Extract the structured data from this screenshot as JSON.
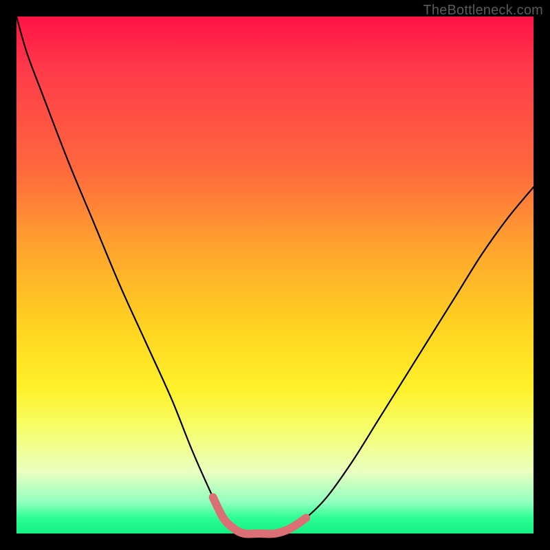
{
  "watermark": "TheBottleneck.com",
  "colors": {
    "background_outer": "#000000",
    "gradient_top": "#ff1245",
    "gradient_mid1": "#ffa52e",
    "gradient_mid2": "#fff12a",
    "gradient_bottom": "#13f183",
    "curve": "#000000",
    "highlight": "#da6f76"
  },
  "chart_data": {
    "type": "line",
    "title": "",
    "xlabel": "",
    "ylabel": "",
    "xlim": [
      0,
      100
    ],
    "ylim": [
      0,
      100
    ],
    "grid": false,
    "series": [
      {
        "name": "bottleneck-curve",
        "x": [
          0,
          2,
          5,
          10,
          15,
          20,
          25,
          30,
          34,
          38,
          40,
          42,
          44,
          47,
          50,
          53,
          56,
          60,
          65,
          70,
          75,
          80,
          85,
          90,
          95,
          100
        ],
        "values": [
          100,
          93,
          85,
          72,
          60,
          48,
          37,
          26,
          16,
          7,
          3,
          1,
          0,
          0,
          0,
          1,
          3,
          7,
          14,
          22,
          30,
          38,
          46,
          54,
          61,
          67
        ]
      },
      {
        "name": "optimal-range-highlight",
        "x": [
          38,
          40,
          42,
          44,
          47,
          50,
          53,
          56
        ],
        "values": [
          7,
          3,
          1,
          0,
          0,
          0,
          1,
          3
        ]
      }
    ],
    "annotations": []
  }
}
